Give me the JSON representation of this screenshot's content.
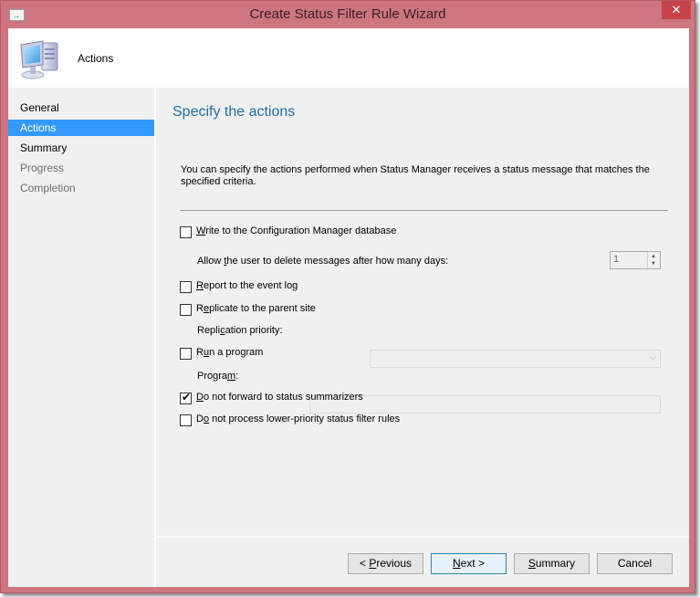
{
  "window": {
    "title": "Create Status Filter Rule Wizard",
    "close_glyph": "✕",
    "app_icon_glyph": "→"
  },
  "header": {
    "title": "Actions",
    "icon": "computer-icon"
  },
  "nav": {
    "items": [
      {
        "label": "General",
        "state": "done"
      },
      {
        "label": "Actions",
        "state": "active"
      },
      {
        "label": "Summary",
        "state": "done"
      },
      {
        "label": "Progress",
        "state": "disabled"
      },
      {
        "label": "Completion",
        "state": "disabled"
      }
    ]
  },
  "content": {
    "title": "Specify the actions",
    "description": "You can specify the actions performed when Status Manager receives a status message that matches the specified criteria.",
    "options": {
      "write_db": {
        "label_pre": "",
        "label_u": "W",
        "label_post": "rite to the Configuration Manager database",
        "checked": false
      },
      "delete_days": {
        "label_pre": "Allow ",
        "label_u": "t",
        "label_post": "he user to delete messages after how many days:",
        "value": "1"
      },
      "event_log": {
        "label_pre": "",
        "label_u": "R",
        "label_post": "eport to the event log",
        "checked": false
      },
      "replicate": {
        "label_pre": "R",
        "label_u": "e",
        "label_post": "plicate to the parent site",
        "checked": false
      },
      "replication_priority": {
        "label_pre": "Repli",
        "label_u": "c",
        "label_post": "ation priority:",
        "value": ""
      },
      "run_program": {
        "label_pre": "R",
        "label_u": "u",
        "label_post": "n a program",
        "checked": false
      },
      "program": {
        "label_pre": "Progra",
        "label_u": "m",
        "label_post": ":",
        "value": ""
      },
      "no_forward": {
        "label_pre": "",
        "label_u": "D",
        "label_post": "o not forward to status summarizers",
        "checked": true
      },
      "no_lower": {
        "label_pre": "D",
        "label_u": "o",
        "label_post": " not process lower-priority status filter rules",
        "checked": false
      }
    }
  },
  "footer": {
    "previous": {
      "pre": "< ",
      "u": "P",
      "post": "revious"
    },
    "next": {
      "pre": "",
      "u": "N",
      "post": "ext >"
    },
    "summary": {
      "pre": "",
      "u": "S",
      "post": "ummary"
    },
    "cancel": {
      "pre": "Cancel",
      "u": "",
      "post": ""
    }
  },
  "colors": {
    "frame": "#cd7680",
    "accent": "#3399ff",
    "title_blue": "#1e6fa8",
    "close_red": "#c7444b"
  }
}
